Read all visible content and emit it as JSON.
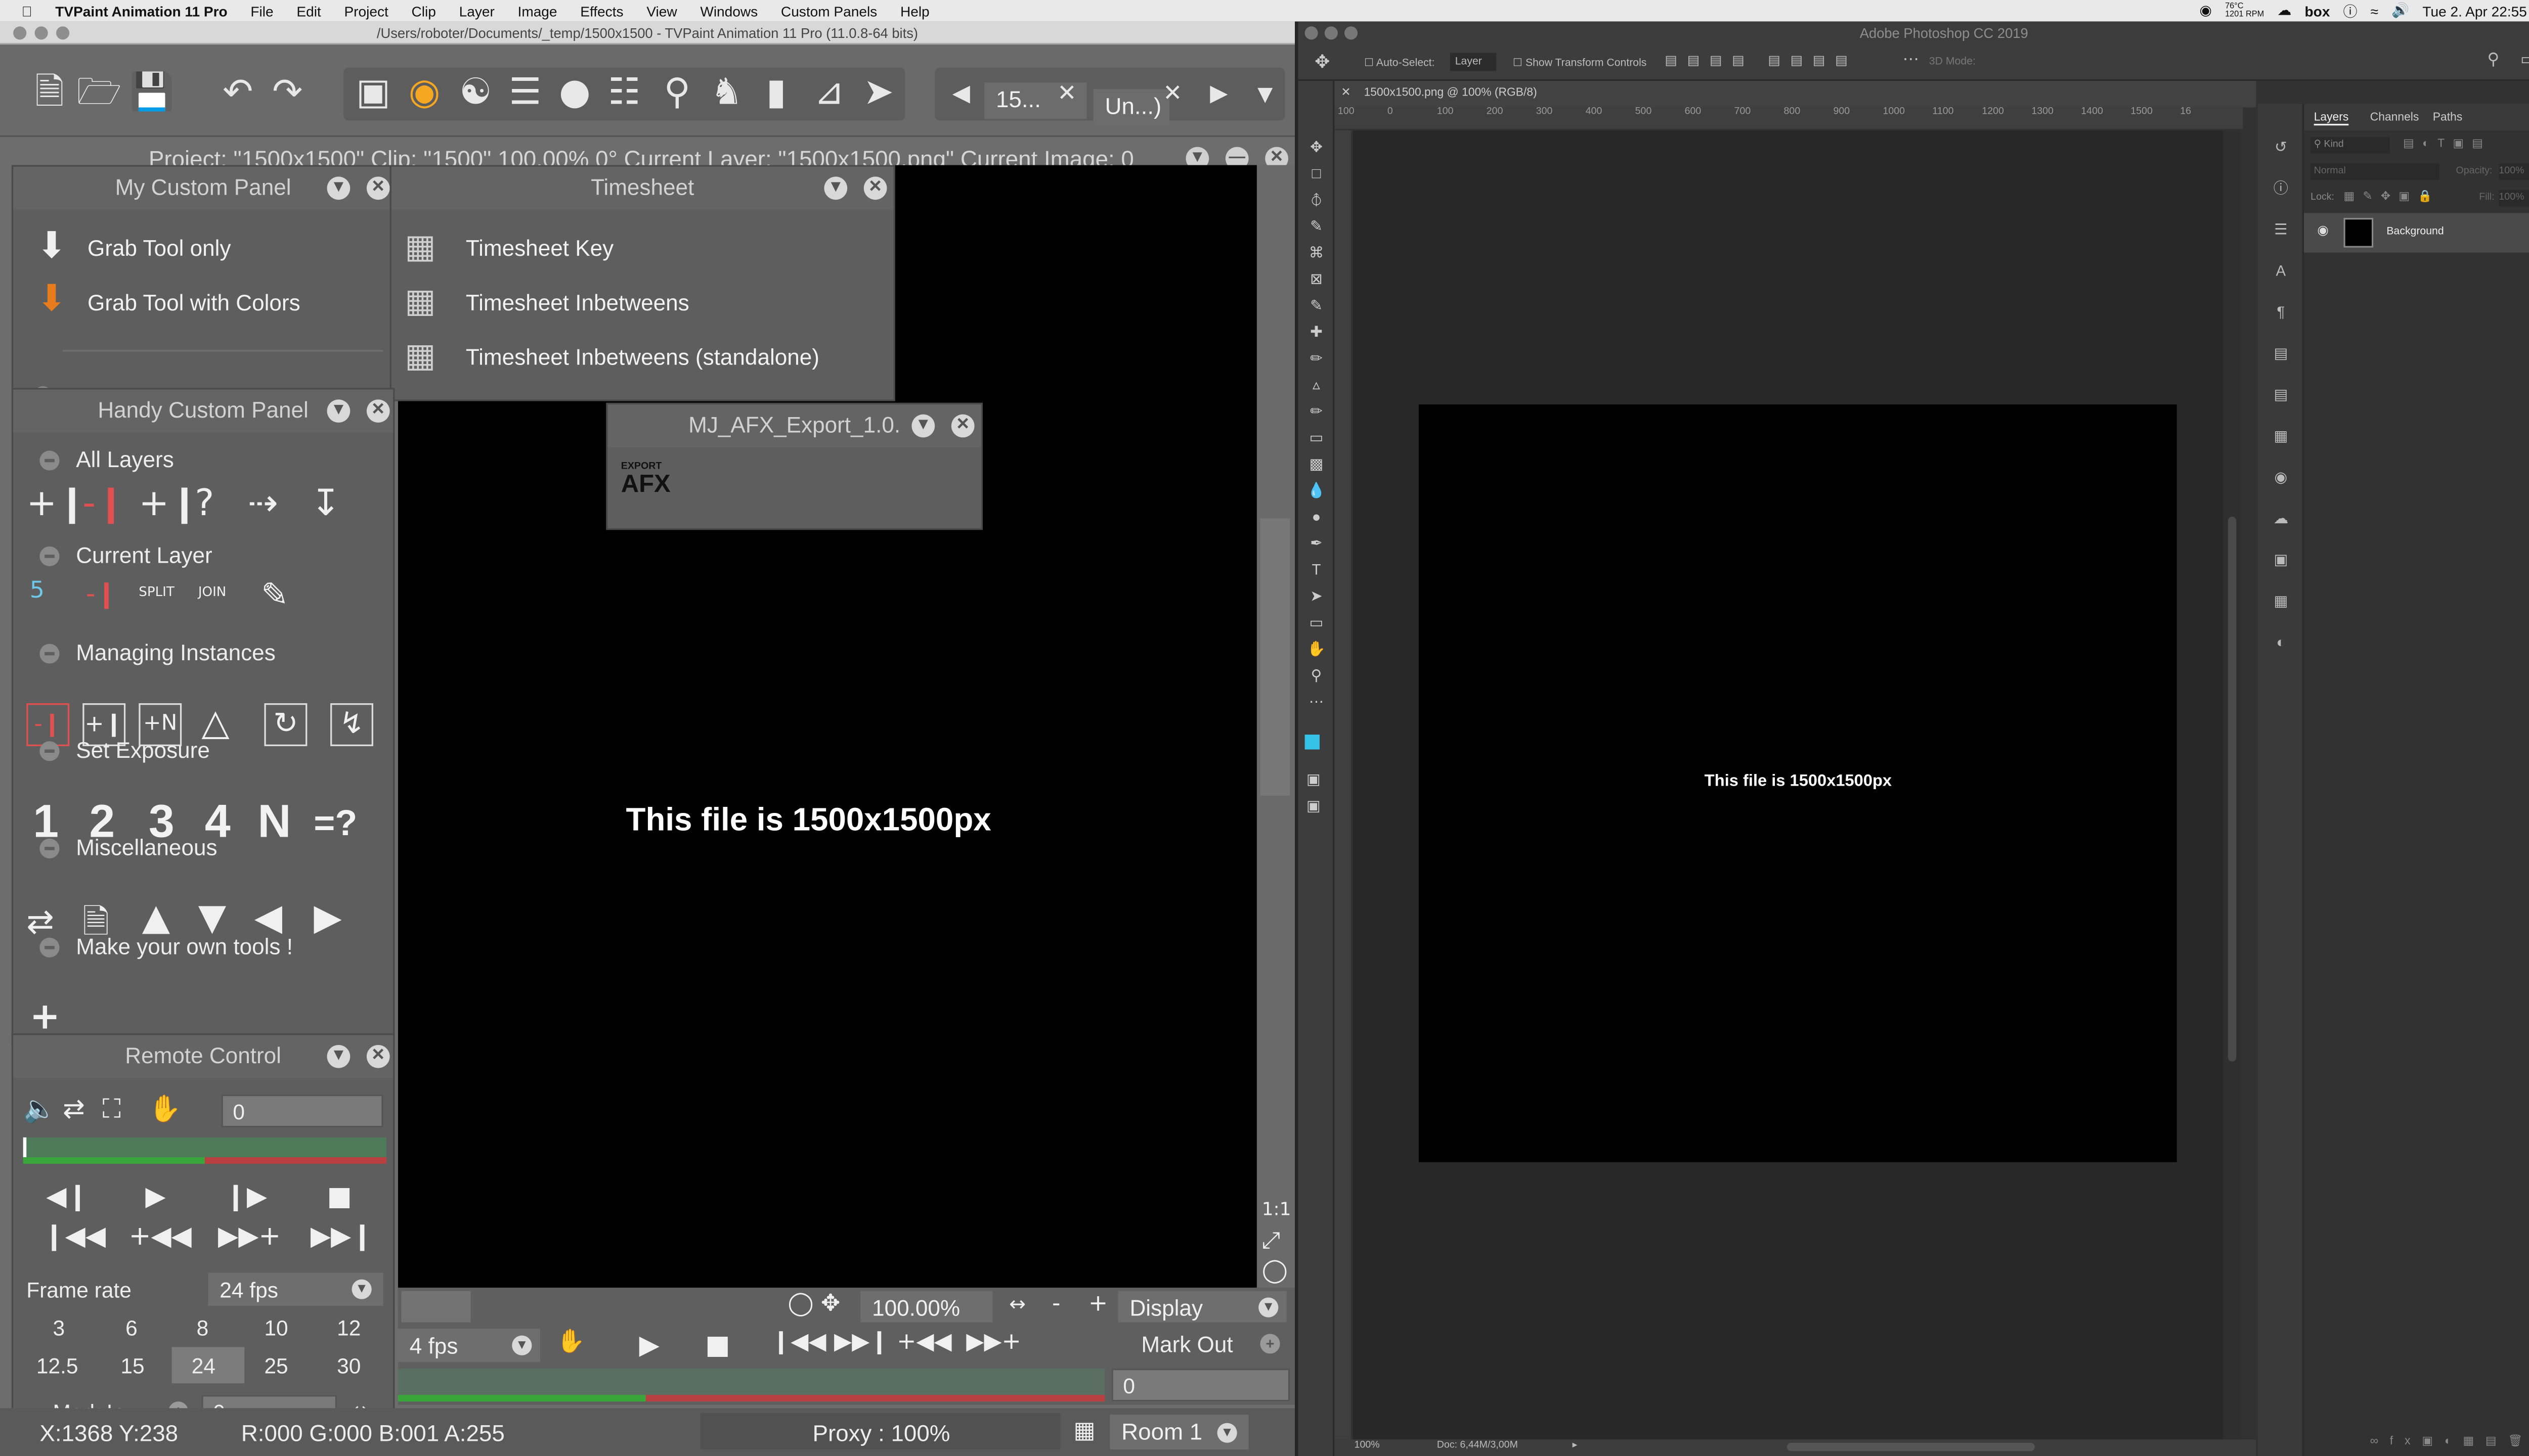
{
  "menubar": {
    "apple": "",
    "app": "TVPaint Animation 11 Pro",
    "items": [
      "File",
      "Edit",
      "Project",
      "Clip",
      "Layer",
      "Image",
      "Effects",
      "View",
      "Windows",
      "Custom Panels",
      "Help"
    ],
    "status": {
      "temp": "76°C",
      "rpm": "1201 RPM",
      "box": "box",
      "datetime": "Tue 2. Apr  22:55"
    }
  },
  "tvpaint": {
    "title": "/Users/roboter/Documents/_temp/1500x1500 - TVPaint Animation 11 Pro (11.0.8-64 bits)",
    "toolbar": {
      "field1": "15...",
      "field2": "Un...)"
    },
    "info": "Project: \"1500x1500\"  Clip: \"1500\"  100.00%  0°  Current Layer: \"1500x1500.png\"  Current Image: 0",
    "my_custom_panel": {
      "title": "My Custom Panel",
      "items": [
        "Grab Tool only",
        "Grab Tool with Colors"
      ]
    },
    "timesheet": {
      "title": "Timesheet",
      "items": [
        "Timesheet Key",
        "Timesheet Inbetweens",
        "Timesheet Inbetweens (standalone)"
      ]
    },
    "mj_panel": {
      "title": "MJ_AFX_Export_1.0.",
      "badge_top": "EXPORT",
      "badge": "AFX"
    },
    "handy_panel": {
      "title": "Handy Custom Panel",
      "sections": [
        "All Layers",
        "Current Layer",
        "Managing Instances",
        "Set Exposure",
        "Miscellaneous",
        "Make your own tools !"
      ],
      "current_layer_labels": [
        "5",
        "",
        "SPLIT",
        "JOIN"
      ],
      "exposure": [
        "1",
        "2",
        "3",
        "4",
        "N",
        "=?"
      ]
    },
    "remote": {
      "title": "Remote Control",
      "frame_value": "0",
      "frame_rate_label": "Frame rate",
      "frame_rate_value": "24 fps",
      "rates_row1": [
        "3",
        "6",
        "8",
        "10",
        "12"
      ],
      "rates_row2": [
        "12.5",
        "15",
        "24",
        "25",
        "30"
      ],
      "selected_rate": "24",
      "mark_in_label": "Mark In",
      "mark_in_value": "0"
    },
    "canvas_text": "This file is 1500x1500px",
    "bottom": {
      "zoom": "100.00%",
      "minus": "-",
      "plus": "+",
      "display": "Display",
      "fps": "4 fps",
      "mark_out": "Mark Out",
      "frame": "0"
    },
    "status": {
      "coords": "X:1368  Y:238",
      "rgba": "R:000 G:000 B:001 A:255",
      "proxy": "Proxy : 100%",
      "room": "Room 1"
    }
  },
  "photoshop": {
    "title": "Adobe Photoshop CC 2019",
    "options": {
      "auto_select": "Auto-Select:",
      "auto_select_value": "Layer",
      "transform": "Show Transform Controls",
      "mode3d": "3D Mode:"
    },
    "doc_tab": "1500x1500.png @ 100% (RGB/8)",
    "ruler_ticks": [
      "100",
      "0",
      "100",
      "200",
      "300",
      "400",
      "500",
      "600",
      "700",
      "800",
      "900",
      "1000",
      "1100",
      "1200",
      "1300",
      "1400",
      "1500",
      "16"
    ],
    "canvas_text": "This file is 1500x1500px",
    "status": {
      "zoom": "100%",
      "doc": "Doc: 6,44M/3,00M"
    },
    "layers_tabs": [
      "Layers",
      "Channels",
      "Paths"
    ],
    "layers": {
      "kind": "Kind",
      "blend": "Normal",
      "opacity_label": "Opacity:",
      "opacity": "100%",
      "lock_label": "Lock:",
      "fill_label": "Fill:",
      "fill": "100%",
      "layer_name": "Background"
    }
  },
  "colors": {
    "accent_green": "#3aa53a",
    "accent_red": "#c23434",
    "selected_rate": "#7c7c7c"
  }
}
